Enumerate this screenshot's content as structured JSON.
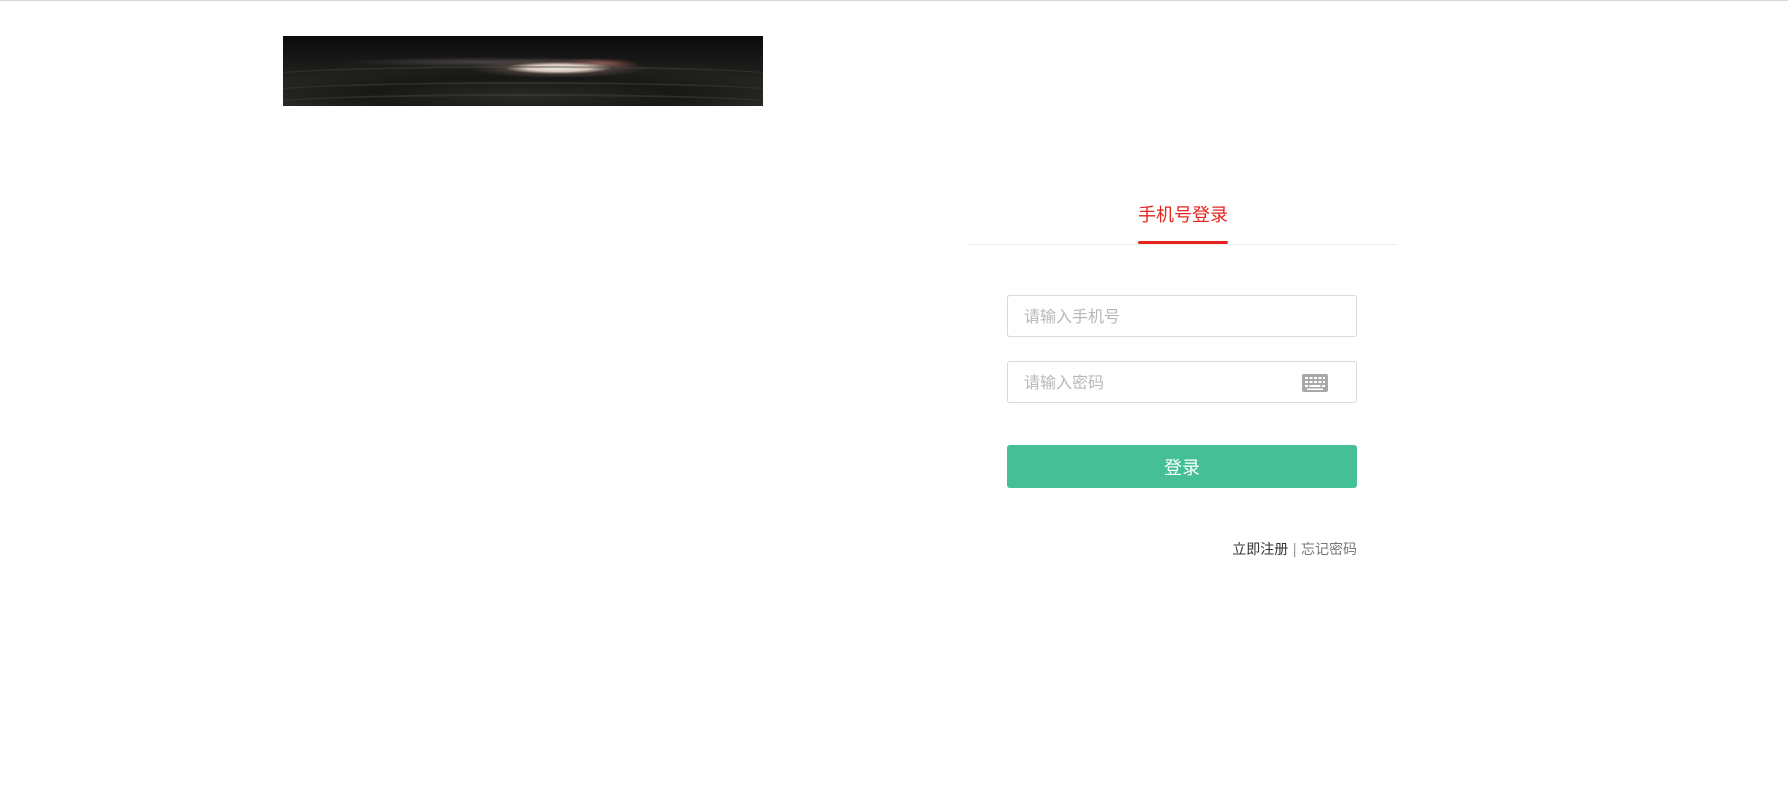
{
  "login": {
    "tab_label": "手机号登录",
    "phone_placeholder": "请输入手机号",
    "password_placeholder": "请输入密码",
    "submit_label": "登录",
    "register_link": "立即注册",
    "separator": "|",
    "forgot_link": "忘记密码"
  },
  "icons": {
    "keyboard": "keyboard-icon"
  },
  "colors": {
    "accent_red": "#e6231e",
    "button_green": "#45c096",
    "input_border": "#d9d9d9",
    "placeholder": "#b7b7b7"
  }
}
